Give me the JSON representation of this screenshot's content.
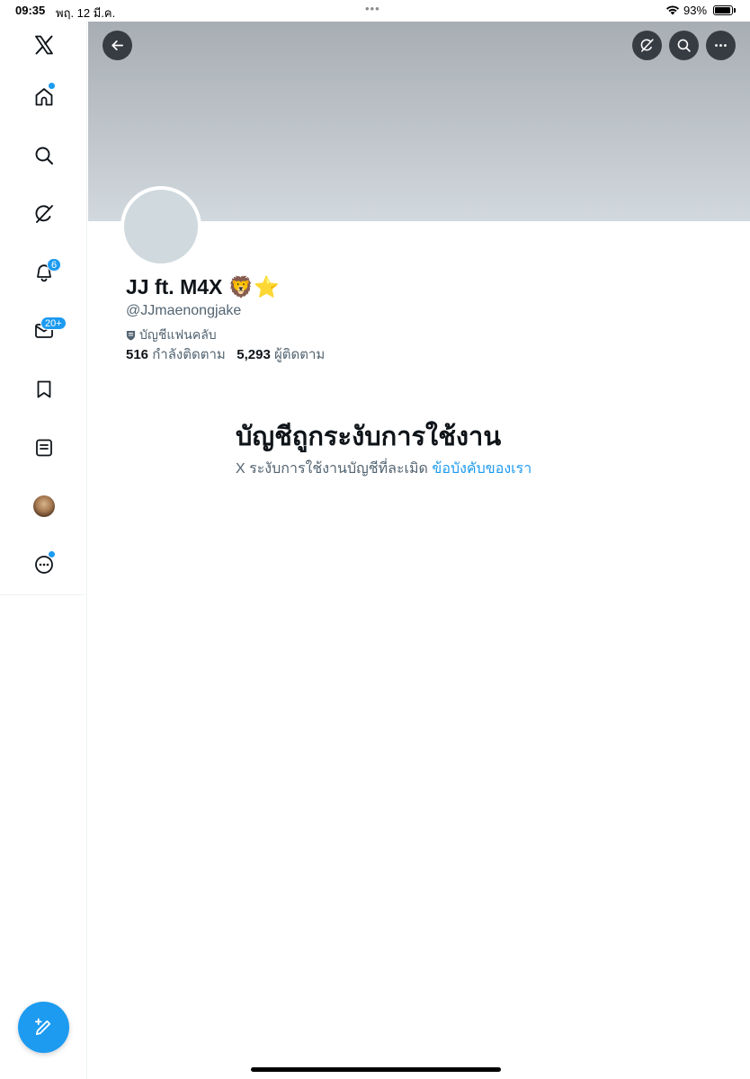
{
  "status_bar": {
    "time": "09:35",
    "date": "พฤ. 12 มี.ค.",
    "battery_text": "93%",
    "battery_level": 0.93,
    "dots": "•••"
  },
  "sidebar": {
    "items": [
      {
        "name": "x-logo",
        "icon": "x-logo-icon"
      },
      {
        "name": "home",
        "icon": "home-icon",
        "dot": true
      },
      {
        "name": "explore",
        "icon": "search-icon"
      },
      {
        "name": "grok",
        "icon": "grok-icon"
      },
      {
        "name": "notifications",
        "icon": "bell-icon",
        "badge": "6"
      },
      {
        "name": "messages",
        "icon": "mail-icon",
        "badge": "20+"
      },
      {
        "name": "bookmarks",
        "icon": "bookmark-icon"
      },
      {
        "name": "lists",
        "icon": "list-icon"
      },
      {
        "name": "profile",
        "icon": "avatar"
      },
      {
        "name": "more",
        "icon": "more-circle-icon",
        "dot": true
      }
    ]
  },
  "profile": {
    "display_name": "JJ ft. M4X 🦁⭐️",
    "handle": "@JJmaenongjake",
    "affiliate_label": "บัญชีแฟนคลับ",
    "following_count": "516",
    "following_label": "กำลังติดตาม",
    "followers_count": "5,293",
    "followers_label": "ผู้ติดตาม"
  },
  "suspension": {
    "title": "บัญชีถูกระงับการใช้งาน",
    "message": "X ระงับการใช้งานบัญชีที่ละเมิด",
    "link_text": "ข้อบังคับของเรา"
  },
  "colors": {
    "accent": "#1d9bf0",
    "text_primary": "#0f1419",
    "text_secondary": "#536471"
  }
}
